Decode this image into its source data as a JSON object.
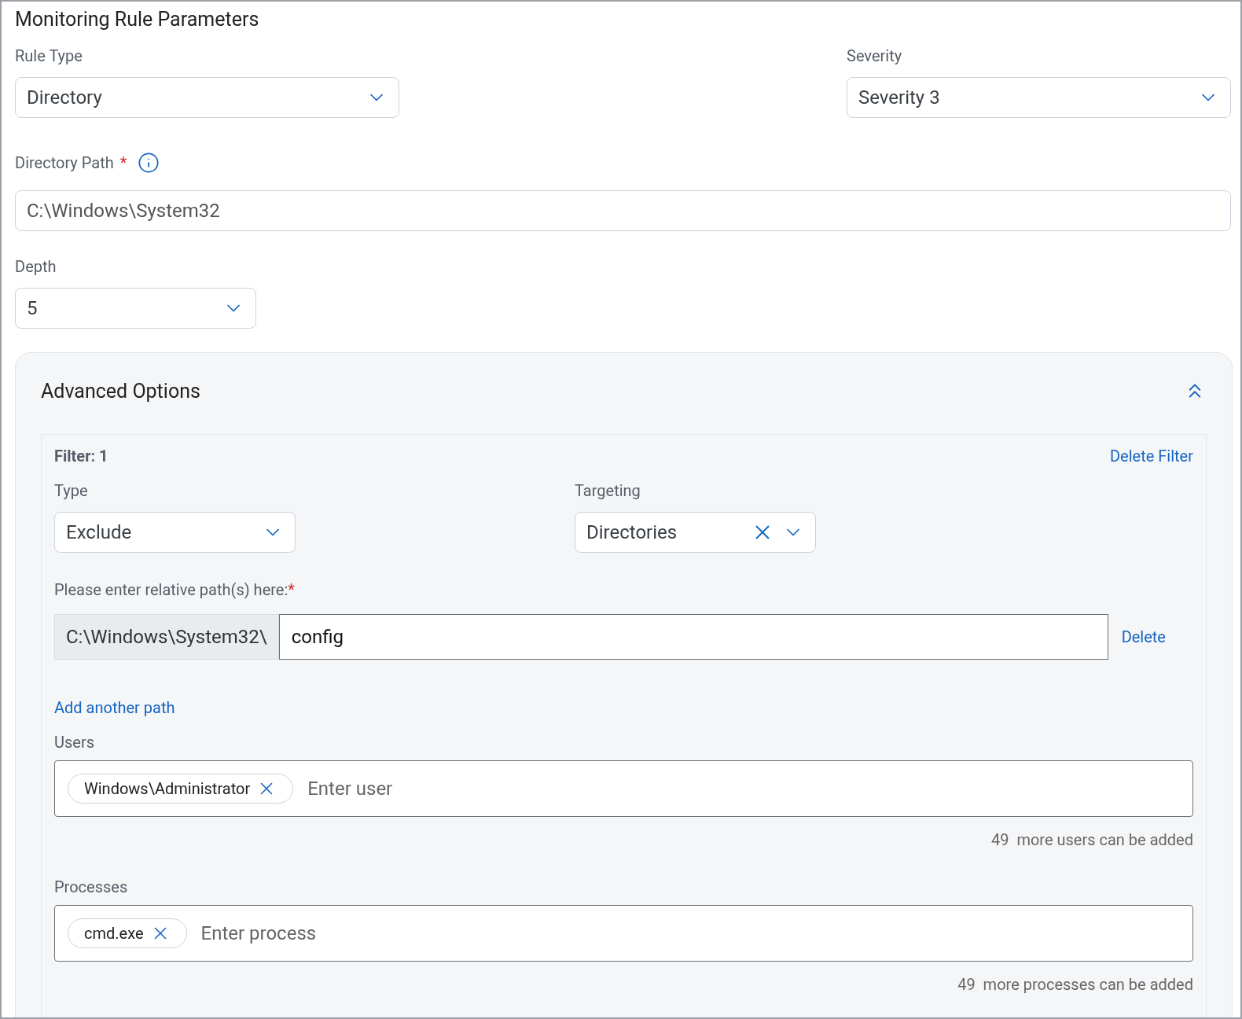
{
  "title": "Monitoring Rule Parameters",
  "rule_type": {
    "label": "Rule Type",
    "value": "Directory"
  },
  "severity": {
    "label": "Severity",
    "value": "Severity 3"
  },
  "directory_path": {
    "label": "Directory Path",
    "required_mark": "*",
    "value": "C:\\Windows\\System32"
  },
  "depth": {
    "label": "Depth",
    "value": "5"
  },
  "advanced_options": {
    "title": "Advanced Options",
    "expanded": true,
    "filter": {
      "title": "Filter: 1",
      "delete_label": "Delete Filter",
      "type": {
        "label": "Type",
        "value": "Exclude"
      },
      "targeting": {
        "label": "Targeting",
        "value": "Directories"
      },
      "paths_label": "Please enter relative path(s) here:",
      "paths_required_mark": "*",
      "paths": [
        {
          "prefix": "C:\\Windows\\System32\\",
          "value": "config",
          "delete_label": "Delete"
        }
      ],
      "add_path_label": "Add another path",
      "users": {
        "label": "Users",
        "chips": [
          "Windows\\Administrator"
        ],
        "placeholder": "Enter user",
        "count": "49",
        "count_text": "more users can be added"
      },
      "processes": {
        "label": "Processes",
        "chips": [
          "cmd.exe"
        ],
        "placeholder": "Enter process",
        "count": "49",
        "count_text": "more processes can be added"
      }
    }
  }
}
